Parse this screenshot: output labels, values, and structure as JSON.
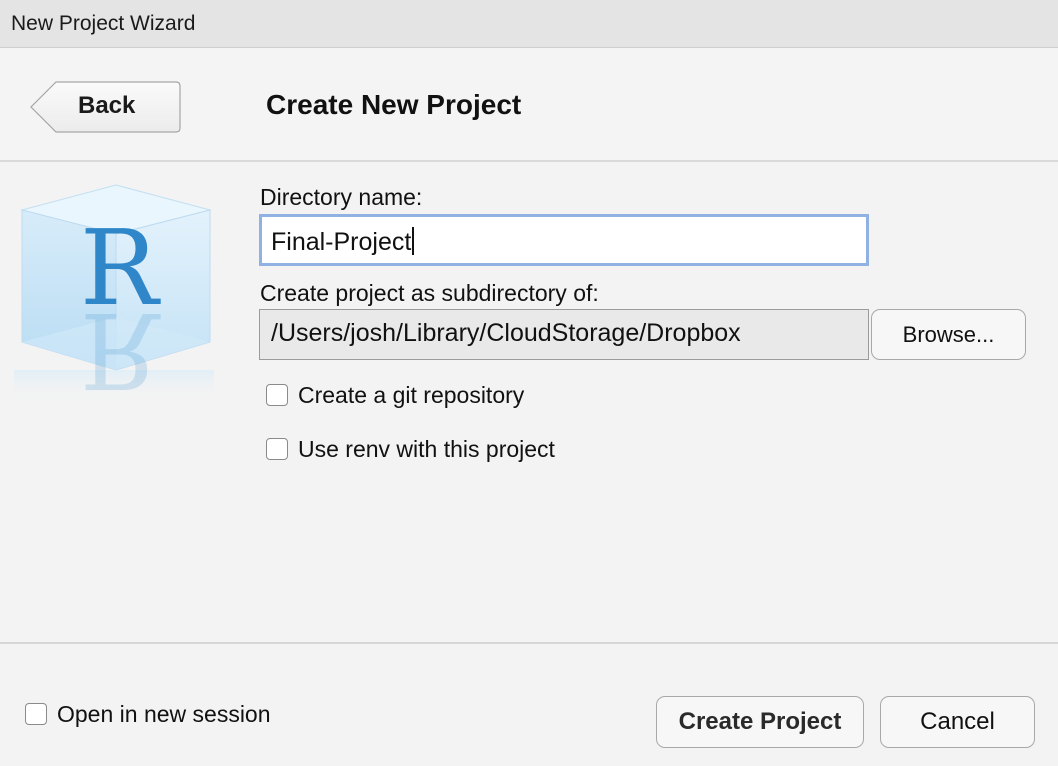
{
  "window": {
    "title": "New Project Wizard"
  },
  "header": {
    "back_label": "Back",
    "title": "Create New Project"
  },
  "form": {
    "directory_label": "Directory name:",
    "directory_value": "Final-Project",
    "parent_label": "Create project as subdirectory of:",
    "parent_value": "/Users/josh/Library/CloudStorage/Dropbox",
    "browse_label": "Browse...",
    "options": [
      {
        "label": "Create a git repository",
        "checked": false
      },
      {
        "label": "Use renv with this project",
        "checked": false
      }
    ]
  },
  "footer": {
    "new_session_label": "Open in new session",
    "new_session_checked": false,
    "create_label": "Create Project",
    "cancel_label": "Cancel"
  },
  "logo": {
    "letter": "R"
  },
  "colors": {
    "focus_border": "#8fb2e3",
    "logo_blue": "#2f86c8"
  },
  "icons": {
    "logo": "r-cube-logo-icon",
    "back": "back-arrow-button-shape"
  }
}
